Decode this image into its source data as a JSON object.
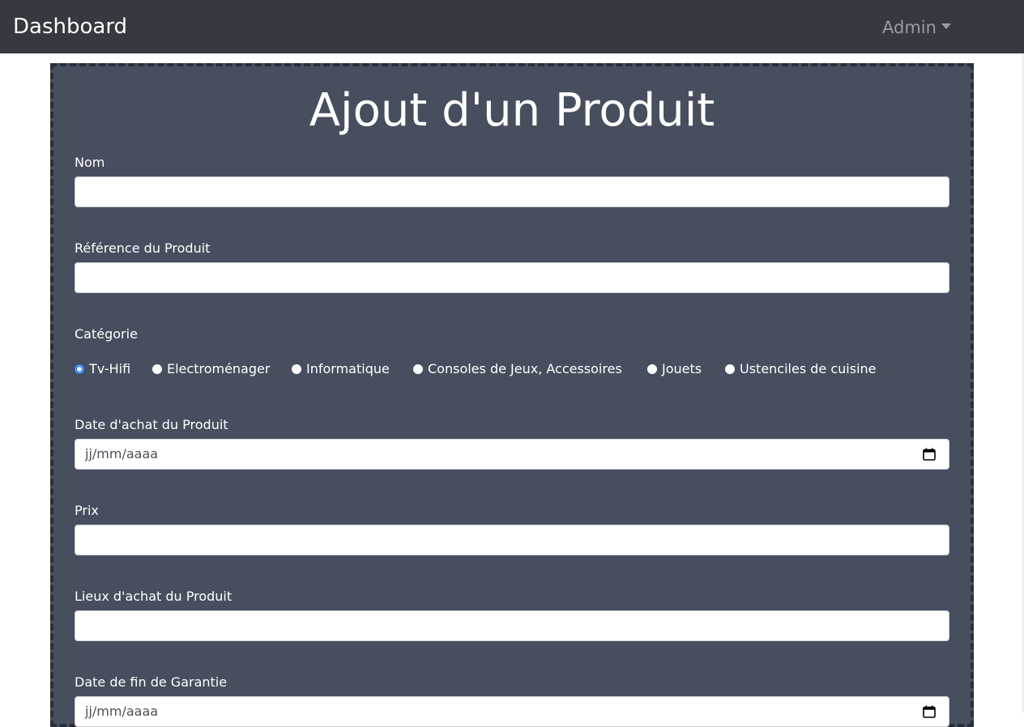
{
  "navbar": {
    "brand": "Dashboard",
    "user_menu_label": "Admin"
  },
  "form": {
    "title": "Ajout d'un Produit",
    "fields": {
      "nom": {
        "label": "Nom",
        "value": ""
      },
      "reference": {
        "label": "Référence du Produit",
        "value": ""
      },
      "categorie": {
        "label": "Catégorie",
        "options": [
          "Tv-Hifi",
          "Electroménager",
          "Informatique",
          "Consoles de Jeux, Accessoires",
          "Jouets",
          "Ustenciles de cuisine"
        ],
        "selected": "Tv-Hifi"
      },
      "date_achat": {
        "label": "Date d'achat du Produit",
        "placeholder": "jj/mm/aaaa"
      },
      "prix": {
        "label": "Prix",
        "value": ""
      },
      "lieux_achat": {
        "label": "Lieux d'achat du Produit",
        "value": ""
      },
      "date_fin_garantie": {
        "label": "Date de fin de Garantie",
        "placeholder": "jj/mm/aaaa"
      }
    }
  },
  "colors": {
    "navbar_bg": "#343a40",
    "panel_bg": "#474e5d",
    "radio_accent": "#0d6efd"
  }
}
